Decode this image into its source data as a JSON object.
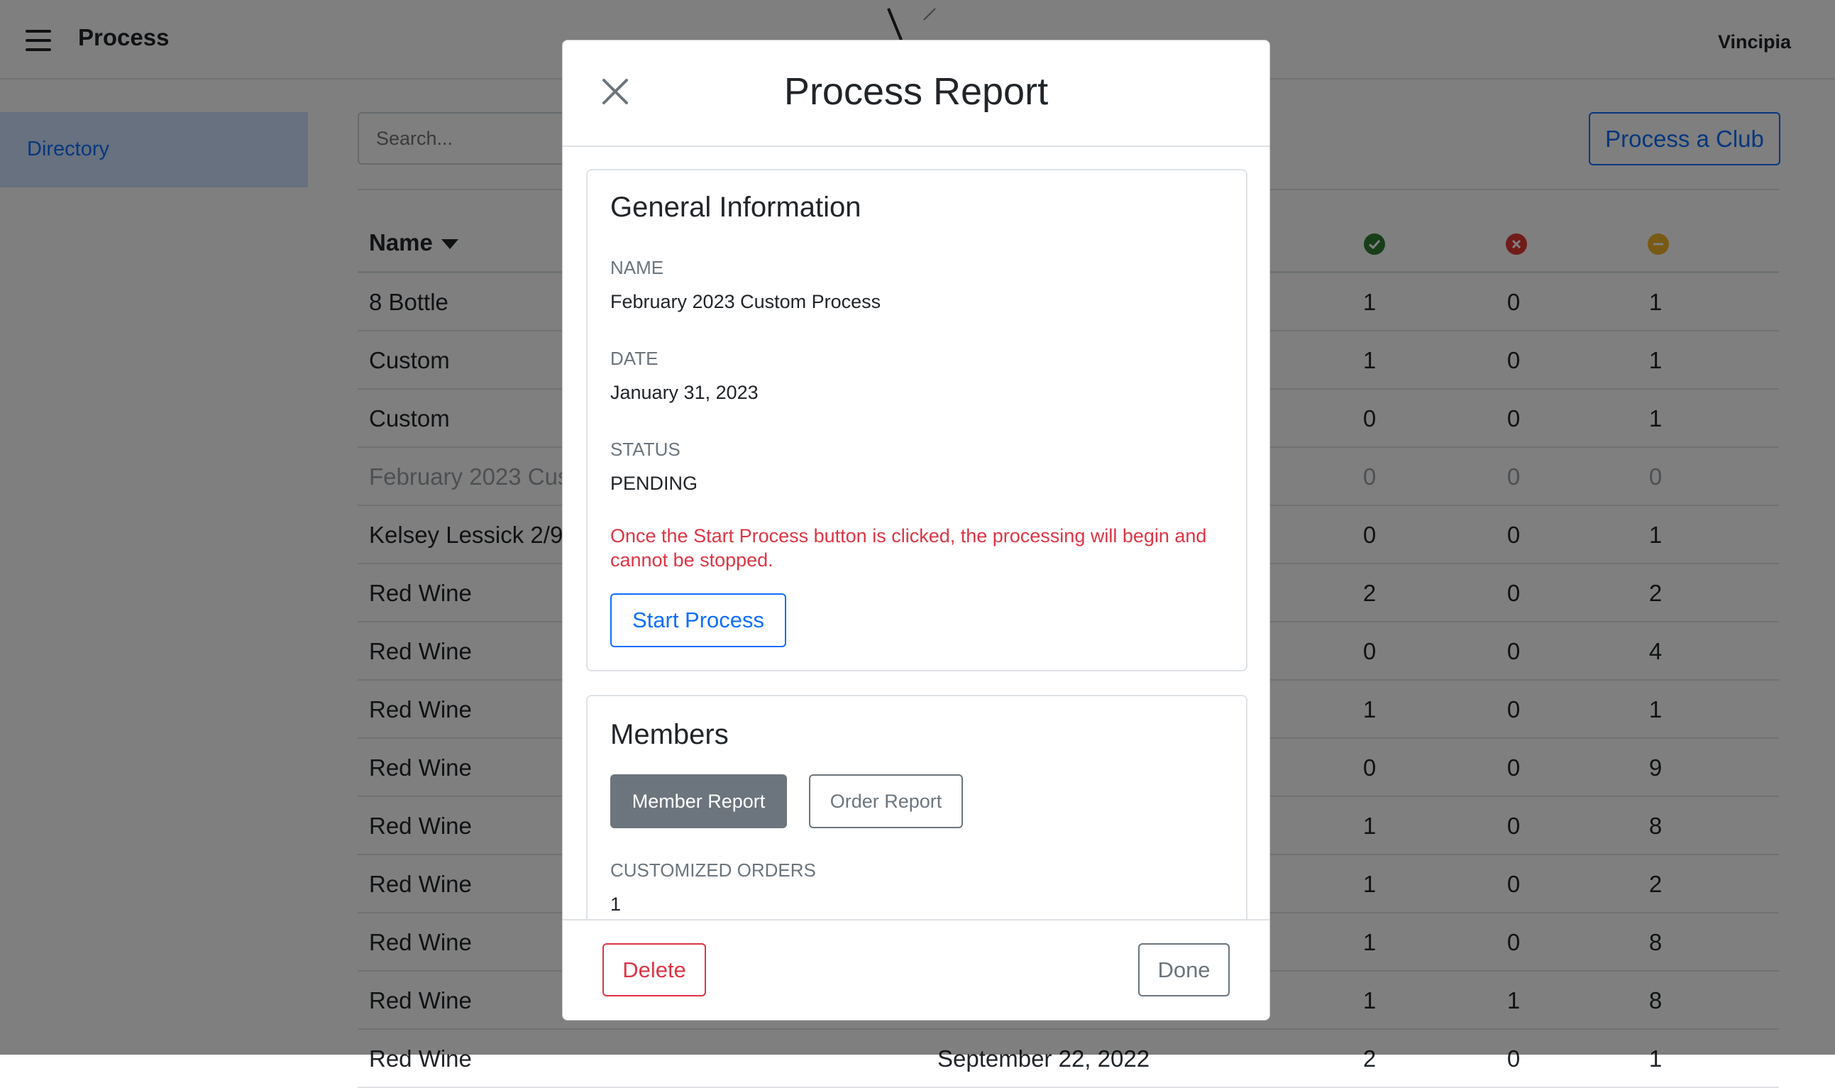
{
  "header": {
    "app_title": "Process",
    "brand": "Vincipia"
  },
  "sidebar": {
    "items": [
      {
        "label": "Directory"
      }
    ]
  },
  "toolbar": {
    "search_placeholder": "Search...",
    "process_club_label": "Process a Club"
  },
  "table": {
    "name_header": "Name",
    "status_colors": {
      "success": "#2e7d32",
      "failed": "#e53935",
      "pending": "#f0b429"
    },
    "rows": [
      {
        "name": "8 Bottle",
        "date": "",
        "success": "1",
        "failed": "0",
        "pending": "1"
      },
      {
        "name": "Custom",
        "date": "",
        "success": "1",
        "failed": "0",
        "pending": "1"
      },
      {
        "name": "Custom",
        "date": "",
        "success": "0",
        "failed": "0",
        "pending": "1"
      },
      {
        "name": "February 2023 Cus",
        "date": "",
        "success": "0",
        "failed": "0",
        "pending": "0"
      },
      {
        "name": "Kelsey Lessick 2/9/",
        "date": "",
        "success": "0",
        "failed": "0",
        "pending": "1"
      },
      {
        "name": "Red Wine",
        "date": "",
        "success": "2",
        "failed": "0",
        "pending": "2"
      },
      {
        "name": "Red Wine",
        "date": "",
        "success": "0",
        "failed": "0",
        "pending": "4"
      },
      {
        "name": "Red Wine",
        "date": "",
        "success": "1",
        "failed": "0",
        "pending": "1"
      },
      {
        "name": "Red Wine",
        "date": "",
        "success": "0",
        "failed": "0",
        "pending": "9"
      },
      {
        "name": "Red Wine",
        "date": "",
        "success": "1",
        "failed": "0",
        "pending": "8"
      },
      {
        "name": "Red Wine",
        "date": "",
        "success": "1",
        "failed": "0",
        "pending": "2"
      },
      {
        "name": "Red Wine",
        "date": "",
        "success": "1",
        "failed": "0",
        "pending": "8"
      },
      {
        "name": "Red Wine",
        "date": "",
        "success": "1",
        "failed": "1",
        "pending": "8"
      },
      {
        "name": "Red Wine",
        "date": "September 22, 2022",
        "success": "2",
        "failed": "0",
        "pending": "1"
      }
    ]
  },
  "modal": {
    "title": "Process Report",
    "general": {
      "heading": "General Information",
      "name_label": "NAME",
      "name_value": "February 2023 Custom Process",
      "date_label": "DATE",
      "date_value": "January 31, 2023",
      "status_label": "STATUS",
      "status_value": "PENDING",
      "warning": "Once the Start Process button is clicked, the processing will begin and cannot be stopped.",
      "start_label": "Start Process",
      "warning_color": "#dc3545"
    },
    "members": {
      "heading": "Members",
      "member_report_label": "Member Report",
      "order_report_label": "Order Report",
      "customized_label": "CUSTOMIZED ORDERS",
      "customized_value": "1"
    },
    "footer": {
      "delete_label": "Delete",
      "done_label": "Done"
    }
  }
}
